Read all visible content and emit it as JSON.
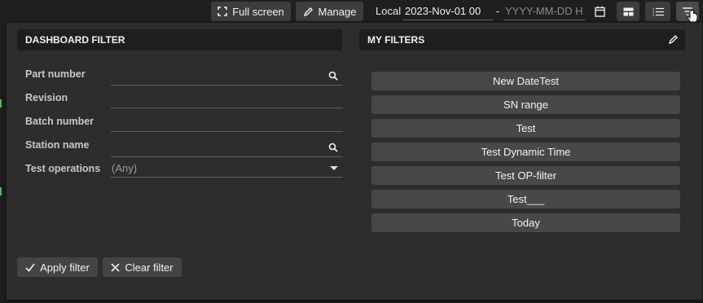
{
  "toolbar": {
    "fullscreen_label": "Full screen",
    "manage_label": "Manage",
    "timezone_label": "Local",
    "date_from": "2023-Nov-01 00",
    "date_separator": "-",
    "date_to_placeholder": "YYYY-MM-DD HH"
  },
  "dashboard_filter": {
    "title": "DASHBOARD FILTER",
    "fields": [
      {
        "label": "Part number",
        "value": ""
      },
      {
        "label": "Revision",
        "value": ""
      },
      {
        "label": "Batch number",
        "value": ""
      },
      {
        "label": "Station name",
        "value": ""
      },
      {
        "label": "Test operations",
        "value": "(Any)"
      }
    ],
    "apply_label": "Apply filter",
    "clear_label": "Clear filter"
  },
  "my_filters": {
    "title": "MY FILTERS",
    "items": [
      "New DateTest",
      "SN range",
      "Test",
      "Test Dynamic Time",
      "Test OP-filter",
      "Test___",
      "Today"
    ]
  },
  "colors": {
    "background": "#1f1f1f",
    "panel": "#2d2d2d",
    "header": "#1e1e1e",
    "button": "#484848",
    "accent_green": "#5fb85f"
  }
}
